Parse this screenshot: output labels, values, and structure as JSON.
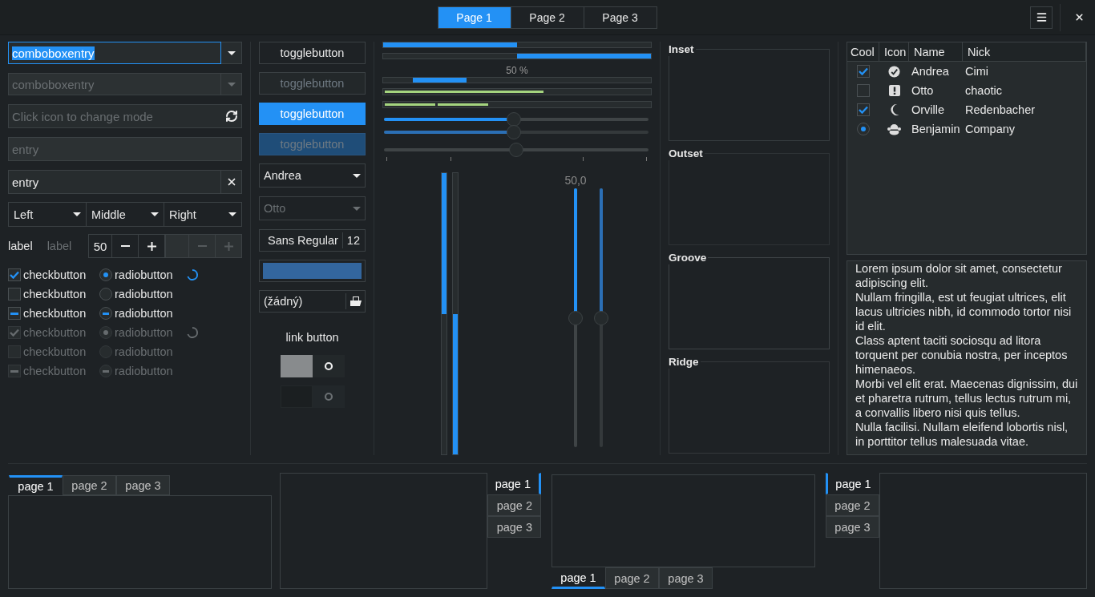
{
  "header": {
    "pages": [
      {
        "label": "Page 1",
        "selected": true
      },
      {
        "label": "Page 2",
        "selected": false
      },
      {
        "label": "Page 3",
        "selected": false
      }
    ]
  },
  "left": {
    "entries": [
      {
        "kind": "combo",
        "value": "comboboxentry",
        "disabled": false,
        "focused": true
      },
      {
        "kind": "combo",
        "value": "comboboxentry",
        "disabled": true,
        "focused": false
      },
      {
        "kind": "mode",
        "placeholder": "Click icon to change mode",
        "disabled": false,
        "focused": false
      },
      {
        "kind": "plain",
        "value": "entry",
        "disabled": true,
        "focused": false
      },
      {
        "kind": "clear",
        "value": "entry",
        "disabled": false,
        "focused": false
      }
    ],
    "linked_combos": [
      {
        "value": "Left"
      },
      {
        "value": "Middle"
      },
      {
        "value": "Right"
      }
    ],
    "labels": [
      {
        "text": "label",
        "disabled": false
      },
      {
        "text": "label",
        "disabled": true
      }
    ],
    "spin_buttons": [
      {
        "value": "50",
        "disabled": false
      },
      {
        "disabled": true
      }
    ],
    "rows": [
      {
        "disabled": false,
        "spinner": true,
        "check": {
          "label": "checkbutton",
          "checked": true,
          "inconsistent": false
        },
        "radio": {
          "label": "radiobutton",
          "selected": true,
          "inconsistent": false
        }
      },
      {
        "disabled": false,
        "spinner": false,
        "check": {
          "label": "checkbutton",
          "checked": false,
          "inconsistent": false
        },
        "radio": {
          "label": "radiobutton",
          "selected": false,
          "inconsistent": false
        }
      },
      {
        "disabled": false,
        "spinner": false,
        "check": {
          "label": "checkbutton",
          "inconsistent": true
        },
        "radio": {
          "label": "radiobutton",
          "inconsistent": true
        }
      },
      {
        "disabled": true,
        "spinner": true,
        "check": {
          "label": "checkbutton",
          "checked": true,
          "inconsistent": false
        },
        "radio": {
          "label": "radiobutton",
          "selected": true,
          "inconsistent": false
        }
      },
      {
        "disabled": true,
        "spinner": false,
        "check": {
          "label": "checkbutton",
          "checked": false,
          "inconsistent": false
        },
        "radio": {
          "label": "radiobutton",
          "selected": false,
          "inconsistent": false
        }
      },
      {
        "disabled": true,
        "spinner": false,
        "check": {
          "label": "checkbutton",
          "inconsistent": true
        },
        "radio": {
          "label": "radiobutton",
          "inconsistent": true
        }
      }
    ]
  },
  "middle": {
    "toggles": [
      {
        "label": "togglebutton",
        "selected": false,
        "disabled": false
      },
      {
        "label": "togglebutton",
        "selected": false,
        "disabled": true
      },
      {
        "label": "togglebutton",
        "selected": true,
        "disabled": false
      },
      {
        "label": "togglebutton",
        "selected": true,
        "disabled": true
      }
    ],
    "combos": [
      {
        "value": "Andrea",
        "disabled": false
      },
      {
        "value": "Otto",
        "disabled": true
      }
    ],
    "font_button": {
      "name": "Sans Regular",
      "size": "12"
    },
    "color_button": {
      "color": "#33669e"
    },
    "file_button": {
      "value": "(žádný)"
    },
    "link": {
      "label": "link button"
    },
    "switches": [
      {
        "on": false,
        "disabled": false
      },
      {
        "on": false,
        "disabled": true
      }
    ]
  },
  "sliders": {
    "progress": [
      {
        "level": 0.5,
        "inverted": false
      },
      {
        "level": 0.5,
        "inverted": true
      }
    ],
    "activity_bar": {
      "text": "50 %",
      "level": 0.2
    },
    "level_bars": [
      {
        "kind": "continuous",
        "level": 0.6
      },
      {
        "kind": "discrete",
        "level": 0.4
      }
    ],
    "scales": [
      {
        "level": 0.49,
        "disabled": false,
        "marks": false
      },
      {
        "level": 0.49,
        "disabled": true,
        "marks": false
      },
      {
        "level": 0.5,
        "marks": true
      }
    ],
    "vertical_progress": [
      {
        "level": 0.5,
        "inverted": false
      },
      {
        "level": 0.5,
        "inverted": true
      }
    ],
    "vertical_scales": [
      {
        "level": 0.5,
        "value": "50,0",
        "disabled": false
      },
      {
        "level": 0.5,
        "disabled": true
      }
    ]
  },
  "frames": [
    {
      "label": "Inset",
      "kind": "inset"
    },
    {
      "label": "Outset",
      "kind": "outset"
    },
    {
      "label": "Groove",
      "kind": "groove"
    },
    {
      "label": "Ridge",
      "kind": "ridge"
    }
  ],
  "tree": {
    "columns": [
      "Cool",
      "Icon",
      "Name",
      "Nick"
    ],
    "rows": [
      {
        "kind": "check",
        "checked": true,
        "name": "Andrea",
        "nick": "Cimi"
      },
      {
        "kind": "check",
        "checked": false,
        "name": "Otto",
        "nick": "chaotic"
      },
      {
        "kind": "check",
        "checked": true,
        "name": "Orville",
        "nick": "Redenbacher"
      },
      {
        "kind": "radio",
        "checked": true,
        "name": "Benjamin",
        "nick": "Company"
      }
    ]
  },
  "text_view": {
    "paragraphs": [
      "Lorem ipsum dolor sit amet, consectetur adipiscing elit.",
      "Nullam fringilla, est ut feugiat ultrices, elit lacus ultricies nibh, id commodo tortor nisi id elit.",
      "Class aptent taciti sociosqu ad litora torquent per conubia nostra, per inceptos himenaeos.",
      "Morbi vel elit erat. Maecenas dignissim, dui et pharetra rutrum, tellus lectus rutrum mi, a convallis libero nisi quis tellus.",
      "Nulla facilisi. Nullam eleifend lobortis nisl, in porttitor tellus malesuada vitae."
    ]
  },
  "notebooks": [
    {
      "kind": "top",
      "tabs": [
        {
          "label": "page 1",
          "selected": true
        },
        {
          "label": "page 2",
          "selected": false
        },
        {
          "label": "page 3",
          "selected": false
        }
      ]
    },
    {
      "kind": "right",
      "tabs": [
        {
          "label": "page 1",
          "selected": true
        },
        {
          "label": "page 2",
          "selected": false
        },
        {
          "label": "page 3",
          "selected": false
        }
      ]
    },
    {
      "kind": "bottom",
      "tabs": [
        {
          "label": "page 1",
          "selected": true
        },
        {
          "label": "page 2",
          "selected": false
        },
        {
          "label": "page 3",
          "selected": false
        }
      ]
    },
    {
      "kind": "left",
      "tabs": [
        {
          "label": "page 1",
          "selected": true
        },
        {
          "label": "page 2",
          "selected": false
        },
        {
          "label": "page 3",
          "selected": false
        }
      ]
    }
  ]
}
